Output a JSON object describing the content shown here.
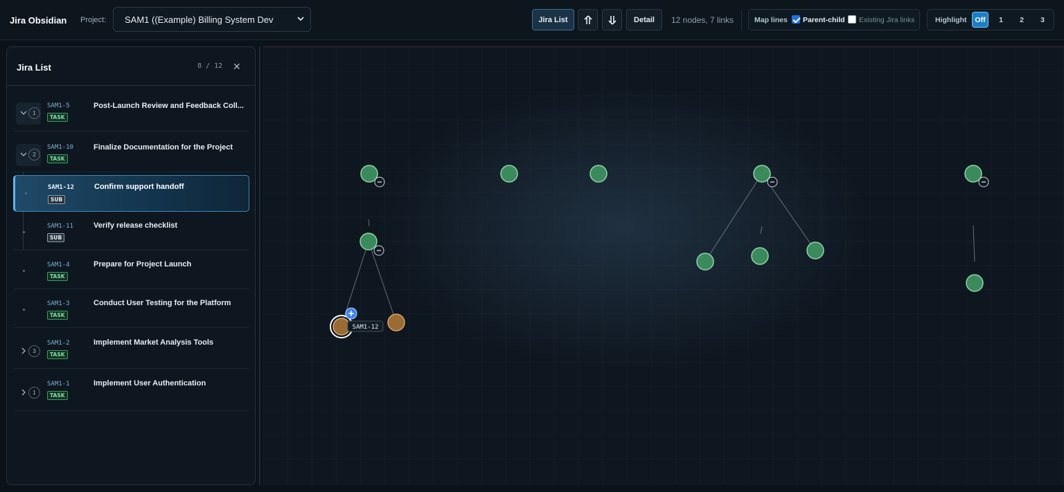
{
  "app": {
    "title": "Jira Obsidian"
  },
  "project": {
    "label": "Project:",
    "selected": "SAM1 ((Example) Billing System Dev)"
  },
  "toolbar": {
    "jira_list": "Jira List",
    "up_icon": "double-arrow-up-icon",
    "down_icon": "double-arrow-down-icon",
    "detail": "Detail",
    "stats": "12 nodes, 7 links",
    "map_lines_label": "Map lines",
    "parent_child_label": "Parent-child",
    "parent_child_checked": true,
    "existing_links_label": "Existing Jira links",
    "existing_links_checked": false,
    "highlight_label": "Highlight",
    "highlight_options": [
      "Off",
      "1",
      "2",
      "3"
    ],
    "highlight_selected": "Off"
  },
  "panel": {
    "title": "Jira List",
    "count": "8 / 12",
    "close_icon": "close-icon",
    "items": [
      {
        "key": "SAM1-5",
        "type": "TASK",
        "summary": "Post-Launch Review and Feedback Coll...",
        "children": "1",
        "state": "expanded"
      },
      {
        "key": "SAM1-10",
        "type": "TASK",
        "summary": "Finalize Documentation for the Project",
        "children": "2",
        "state": "expanded"
      },
      {
        "key": "SAM1-12",
        "type": "SUB",
        "summary": "Confirm support handoff",
        "state": "leaf",
        "selected": true
      },
      {
        "key": "SAM1-11",
        "type": "SUB",
        "summary": "Verify release checklist",
        "state": "leaf"
      },
      {
        "key": "SAM1-4",
        "type": "TASK",
        "summary": "Prepare for Project Launch",
        "state": "leaf"
      },
      {
        "key": "SAM1-3",
        "type": "TASK",
        "summary": "Conduct User Testing for the Platform",
        "state": "leaf"
      },
      {
        "key": "SAM1-2",
        "type": "TASK",
        "summary": "Implement Market Analysis Tools",
        "children": "3",
        "state": "collapsed"
      },
      {
        "key": "SAM1-1",
        "type": "TASK",
        "summary": "Implement User Authentication",
        "children": "1",
        "state": "collapsed"
      }
    ]
  },
  "graph": {
    "selected_label": "SAM1-12",
    "colors": {
      "task": "#3a8a5c",
      "task_border": "#8fd4a8",
      "sub": "#9a6b35",
      "sub_border": "#d7a56a",
      "link": "#8a97a3",
      "badge": "#3b82f6"
    },
    "collapse_icon": "minus-icon",
    "add_icon": "plus-icon"
  }
}
